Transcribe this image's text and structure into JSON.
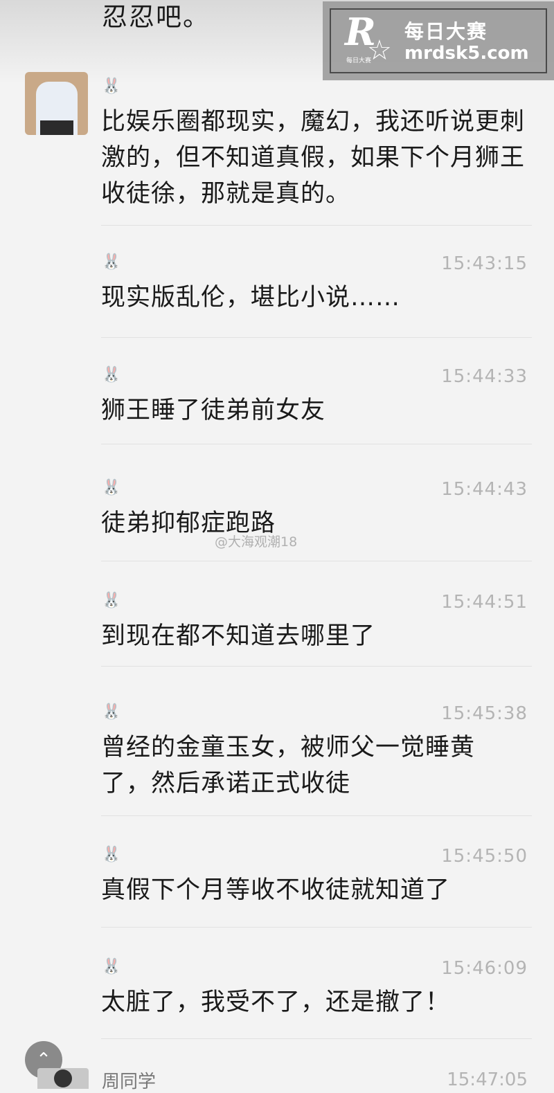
{
  "top_fragment": "忍忍吧。",
  "watermark": {
    "title": "每日大赛",
    "url": "mrdsk5.com",
    "logo_letter": "R",
    "logo_small": "每日大赛"
  },
  "weibo_watermark": "@大海观潮18",
  "scroll_up_icon": "⌃",
  "messages": [
    {
      "sender_icon": "🐰",
      "time": "",
      "text": "比娱乐圈都现实，魔幻，我还听说更刺激的，但不知道真假，如果下个月狮王收徒徐，那就是真的。"
    },
    {
      "sender_icon": "🐰",
      "time": "15:43:15",
      "text": "现实版乱伦，堪比小说……"
    },
    {
      "sender_icon": "🐰",
      "time": "15:44:33",
      "text": "狮王睡了徒弟前女友"
    },
    {
      "sender_icon": "🐰",
      "time": "15:44:43",
      "text": "徒弟抑郁症跑路"
    },
    {
      "sender_icon": "🐰",
      "time": "15:44:51",
      "text": "到现在都不知道去哪里了"
    },
    {
      "sender_icon": "🐰",
      "time": "15:45:38",
      "text": "曾经的金童玉女，被师父一觉睡黄了，然后承诺正式收徒"
    },
    {
      "sender_icon": "🐰",
      "time": "15:45:50",
      "text": "真假下个月等收不收徒就知道了"
    },
    {
      "sender_icon": "🐰",
      "time": "15:46:09",
      "text": "太脏了，我受不了，还是撤了！"
    }
  ],
  "bottom_message": {
    "name": "周同学",
    "time": "15:47:05"
  }
}
